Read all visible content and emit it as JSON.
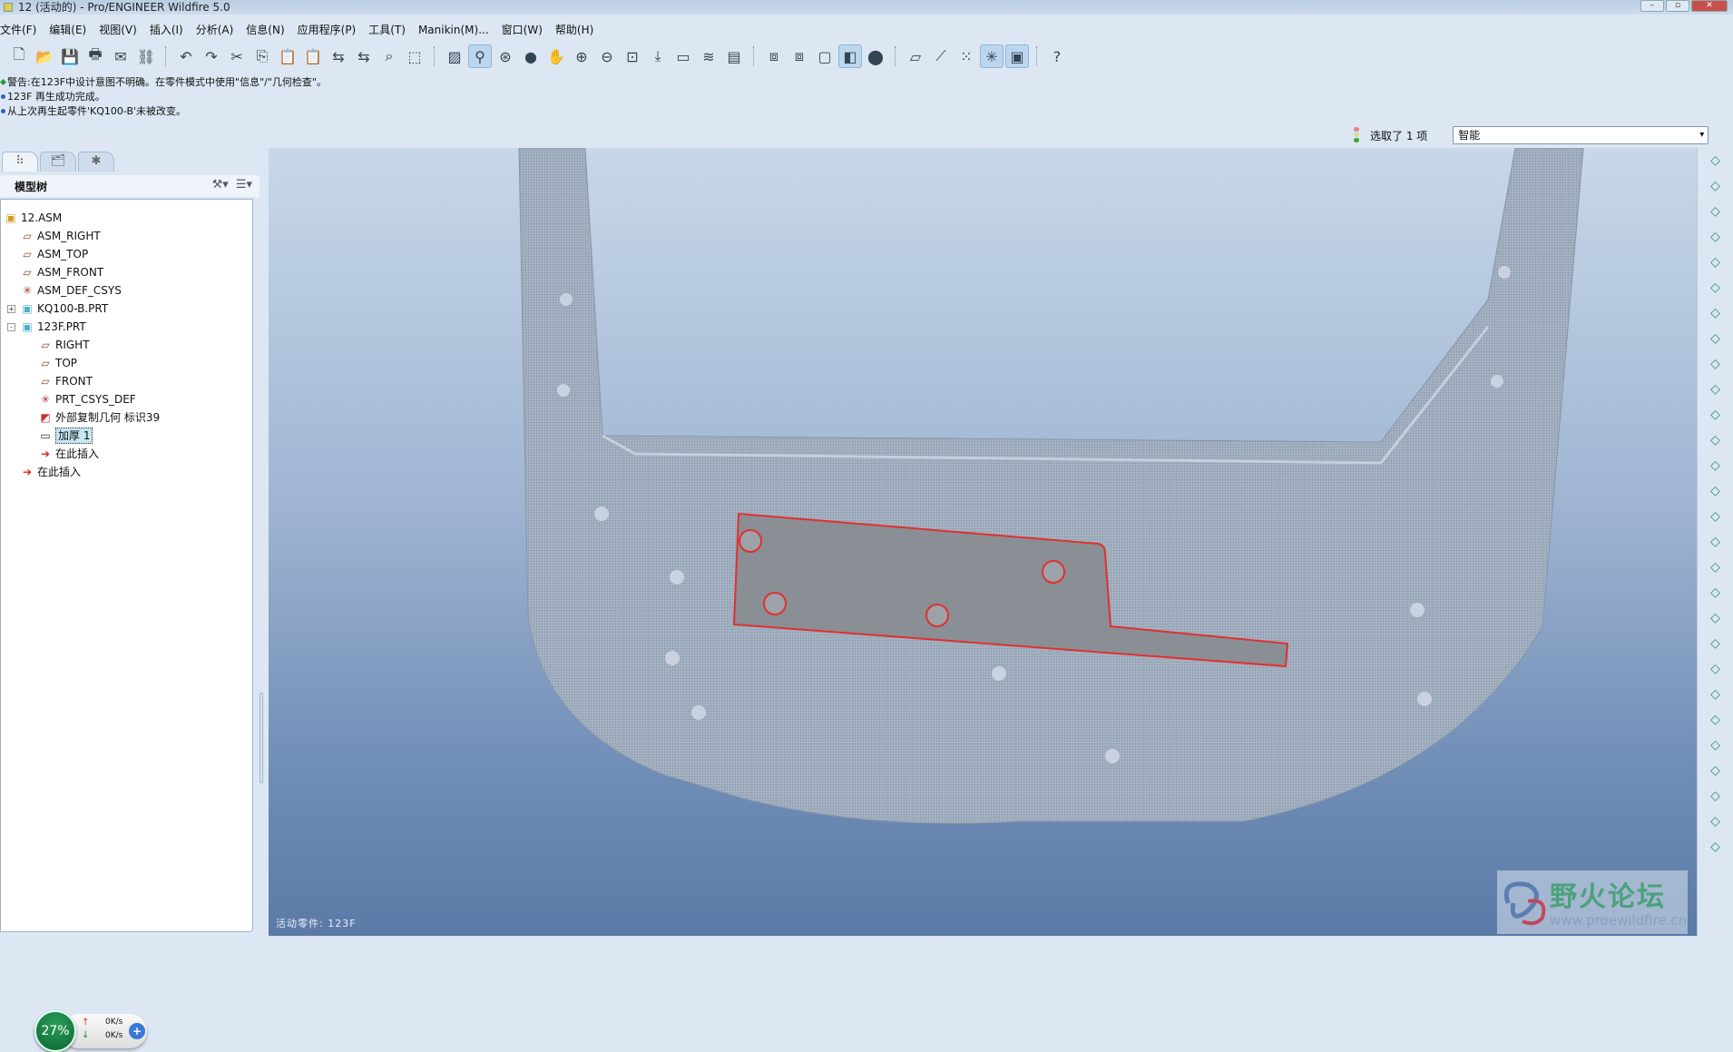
{
  "window": {
    "title": "12 (活动的) - Pro/ENGINEER Wildfire 5.0"
  },
  "menu": [
    "文件(F)",
    "编辑(E)",
    "视图(V)",
    "插入(I)",
    "分析(A)",
    "信息(N)",
    "应用程序(P)",
    "工具(T)",
    "Manikin(M)...",
    "窗口(W)",
    "帮助(H)"
  ],
  "toolbar": {
    "groups": [
      [
        "new-icon",
        "open-icon",
        "save-icon",
        "print-icon",
        "send-mail-icon",
        "send-link-icon"
      ],
      [
        "undo-icon",
        "redo-icon",
        "cut-icon",
        "copy-icon",
        "paste-icon",
        "paste-special-icon",
        "regenerate-icon",
        "regen-manager-icon",
        "find-icon",
        "select-box-icon"
      ],
      [
        "sketcher-icon",
        "datum-toggle-icon",
        "spin-center-icon",
        "appearance-icon",
        "orient-icon",
        "zoom-in-icon",
        "zoom-out-icon",
        "refit-icon",
        "reorient-icon",
        "saved-views-icon",
        "layers-icon",
        "view-manager-icon"
      ],
      [
        "wireframe-icon",
        "hidden-line-icon",
        "no-hidden-icon",
        "shading-icon",
        "enhanced-realism-icon"
      ],
      [
        "datum-plane-display-icon",
        "datum-axis-display-icon",
        "datum-point-display-icon",
        "csys-display-icon",
        "annotation-display-icon"
      ],
      [
        "context-help-icon"
      ]
    ]
  },
  "messages": [
    {
      "type": "warning",
      "text": "警告:在123F中设计意图不明确。在零件模式中使用\"信息\"/\"几何检查\"。"
    },
    {
      "type": "info",
      "text": "123F 再生成功完成。"
    },
    {
      "type": "info",
      "text": "从上次再生起零件'KQ100-B'未被改变。"
    }
  ],
  "status": {
    "selection": "选取了 1 项",
    "filter": "智能"
  },
  "panel": {
    "title": "模型树"
  },
  "tree": [
    {
      "label": "12.ASM",
      "icon": "assembly-icon",
      "level": 0
    },
    {
      "label": "ASM_RIGHT",
      "icon": "datum-plane-icon",
      "level": 1
    },
    {
      "label": "ASM_TOP",
      "icon": "datum-plane-icon",
      "level": 1
    },
    {
      "label": "ASM_FRONT",
      "icon": "datum-plane-icon",
      "level": 1
    },
    {
      "label": "ASM_DEF_CSYS",
      "icon": "csys-icon",
      "level": 1
    },
    {
      "label": "KQ100-B.PRT",
      "icon": "part-icon",
      "level": 1,
      "expander": "+"
    },
    {
      "label": "123F.PRT",
      "icon": "active-part-icon",
      "level": 1,
      "expander": "-"
    },
    {
      "label": "RIGHT",
      "icon": "datum-plane-icon",
      "level": 2
    },
    {
      "label": "TOP",
      "icon": "datum-plane-icon",
      "level": 2
    },
    {
      "label": "FRONT",
      "icon": "datum-plane-icon",
      "level": 2
    },
    {
      "label": "PRT_CSYS_DEF",
      "icon": "csys-icon",
      "level": 2
    },
    {
      "label": "外部复制几何 标识39",
      "icon": "external-copy-geom-icon",
      "level": 2
    },
    {
      "label": "加厚 1",
      "icon": "thicken-icon",
      "level": 2,
      "selected": true
    },
    {
      "label": "在此插入",
      "icon": "insert-here-arrow-icon",
      "level": 2
    },
    {
      "label": "在此插入",
      "icon": "insert-here-arrow-icon",
      "level": 1
    }
  ],
  "network": {
    "percent": "27%",
    "upload": "0K/s",
    "download": "0K/s"
  },
  "viewport": {
    "active_part": "活动零件: 123F",
    "highlight_color": "#e03030"
  },
  "watermark": {
    "name": "野火论坛",
    "url": "www.proewildfire.cn"
  }
}
